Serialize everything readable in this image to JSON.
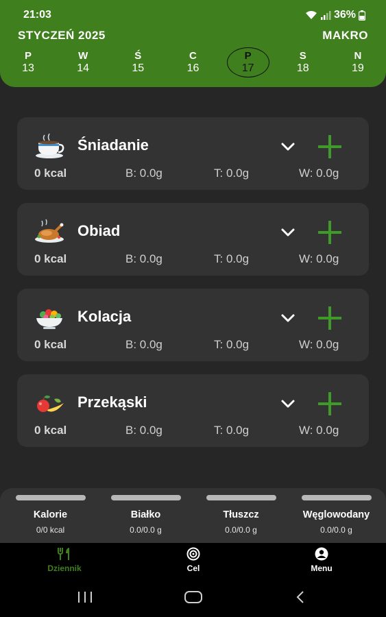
{
  "status": {
    "time": "21:03",
    "battery": "36%"
  },
  "header": {
    "month": "STYCZEŃ 2025",
    "mode_button": "MAKRO",
    "days": [
      {
        "letter": "P",
        "number": "13"
      },
      {
        "letter": "W",
        "number": "14"
      },
      {
        "letter": "Ś",
        "number": "15"
      },
      {
        "letter": "C",
        "number": "16"
      },
      {
        "letter": "P",
        "number": "17",
        "selected": true
      },
      {
        "letter": "S",
        "number": "18"
      },
      {
        "letter": "N",
        "number": "19"
      }
    ]
  },
  "meals": [
    {
      "name": "Śniadanie",
      "icon": "coffee-cup-icon",
      "kcal": "0 kcal",
      "protein": "B: 0.0g",
      "fat": "T: 0.0g",
      "carbs": "W: 0.0g"
    },
    {
      "name": "Obiad",
      "icon": "roast-chicken-icon",
      "kcal": "0 kcal",
      "protein": "B: 0.0g",
      "fat": "T: 0.0g",
      "carbs": "W: 0.0g"
    },
    {
      "name": "Kolacja",
      "icon": "salad-bowl-icon",
      "kcal": "0 kcal",
      "protein": "B: 0.0g",
      "fat": "T: 0.0g",
      "carbs": "W: 0.0g"
    },
    {
      "name": "Przekąski",
      "icon": "fruit-icon",
      "kcal": "0 kcal",
      "protein": "B: 0.0g",
      "fat": "T: 0.0g",
      "carbs": "W: 0.0g"
    }
  ],
  "summary": [
    {
      "label": "Kalorie",
      "value": "0/0 kcal"
    },
    {
      "label": "Białko",
      "value": "0.0/0.0 g"
    },
    {
      "label": "Tłuszcz",
      "value": "0.0/0.0 g"
    },
    {
      "label": "Węglowodany",
      "value": "0.0/0.0 g"
    }
  ],
  "nav": {
    "journal": "Dziennik",
    "goal": "Cel",
    "menu": "Menu"
  },
  "colors": {
    "accent": "#3f7f1e",
    "background": "#262626",
    "card": "#333333"
  }
}
